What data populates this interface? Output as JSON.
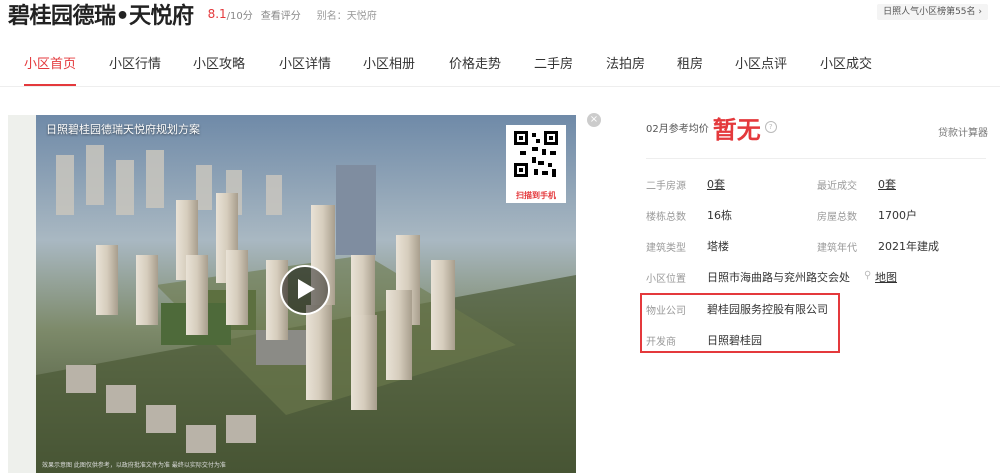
{
  "header": {
    "title": "碧桂园德瑞•天悦府",
    "score": "8.1",
    "score_unit": "/10分",
    "score_link": "查看评分",
    "alias": "别名：天悦府",
    "rank_badge": "日照人气小区榜第55名 ›"
  },
  "nav": {
    "items": [
      {
        "label": "小区首页",
        "active": true
      },
      {
        "label": "小区行情"
      },
      {
        "label": "小区攻略"
      },
      {
        "label": "小区详情"
      },
      {
        "label": "小区相册"
      },
      {
        "label": "价格走势"
      },
      {
        "label": "二手房"
      },
      {
        "label": "法拍房"
      },
      {
        "label": "租房"
      },
      {
        "label": "小区点评"
      },
      {
        "label": "小区成交"
      }
    ]
  },
  "media": {
    "plan_title": "日照碧桂园德瑞天悦府规划方案",
    "qr_label": "扫描到手机",
    "footnote": "效果示意图 此图仅供参考，以政府批准文件为准 最终以实际交付为准"
  },
  "price": {
    "label": "02月参考均价",
    "value": "暂无",
    "calc_link": "贷款计算器"
  },
  "info": {
    "second_hand_label": "二手房源",
    "second_hand_value": "0套",
    "recent_deal_label": "最近成交",
    "recent_deal_value": "0套",
    "buildings_label": "楼栋总数",
    "buildings_value": "16栋",
    "houses_label": "房屋总数",
    "houses_value": "1700户",
    "type_label": "建筑类型",
    "type_value": "塔楼",
    "year_label": "建筑年代",
    "year_value": "2021年建成",
    "location_label": "小区位置",
    "location_value": "日照市海曲路与兖州路交会处",
    "map_link": "地图",
    "property_label": "物业公司",
    "property_value": "碧桂园服务控股有限公司",
    "developer_label": "开发商",
    "developer_value": "日照碧桂园"
  },
  "colors": {
    "accent": "#e4393c"
  }
}
